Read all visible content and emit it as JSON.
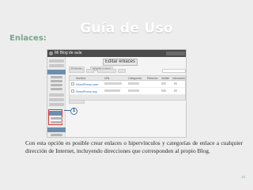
{
  "slide": {
    "title": "Guía de Uso",
    "section_heading": "Enlaces:",
    "body_text": "Con esta opción es posible crear enlaces o hipervínculos y categorías de enlace a cualquier dirección de Internet, incluyendo direcciones que corresponden al propio Blog.",
    "page_number": "16"
  },
  "screenshot": {
    "site_name": "Mi Blog de aula",
    "page_title": "Editar enlaces",
    "tabs": [
      "Enlaces",
      "Añadir nuevo"
    ],
    "table_headers": [
      "Nombre",
      "URL",
      "Categorías",
      "Relación",
      "Visible",
      "Valoración"
    ],
    "rows": [
      {
        "name": "WordPress.com"
      },
      {
        "name": "WordPress.org"
      }
    ],
    "callout": "1"
  },
  "colors": {
    "background": "#ecedec",
    "title": "#ffffff",
    "heading": "#7aa48e",
    "highlight": "#d23a3a",
    "callout": "#3e6fb0"
  }
}
